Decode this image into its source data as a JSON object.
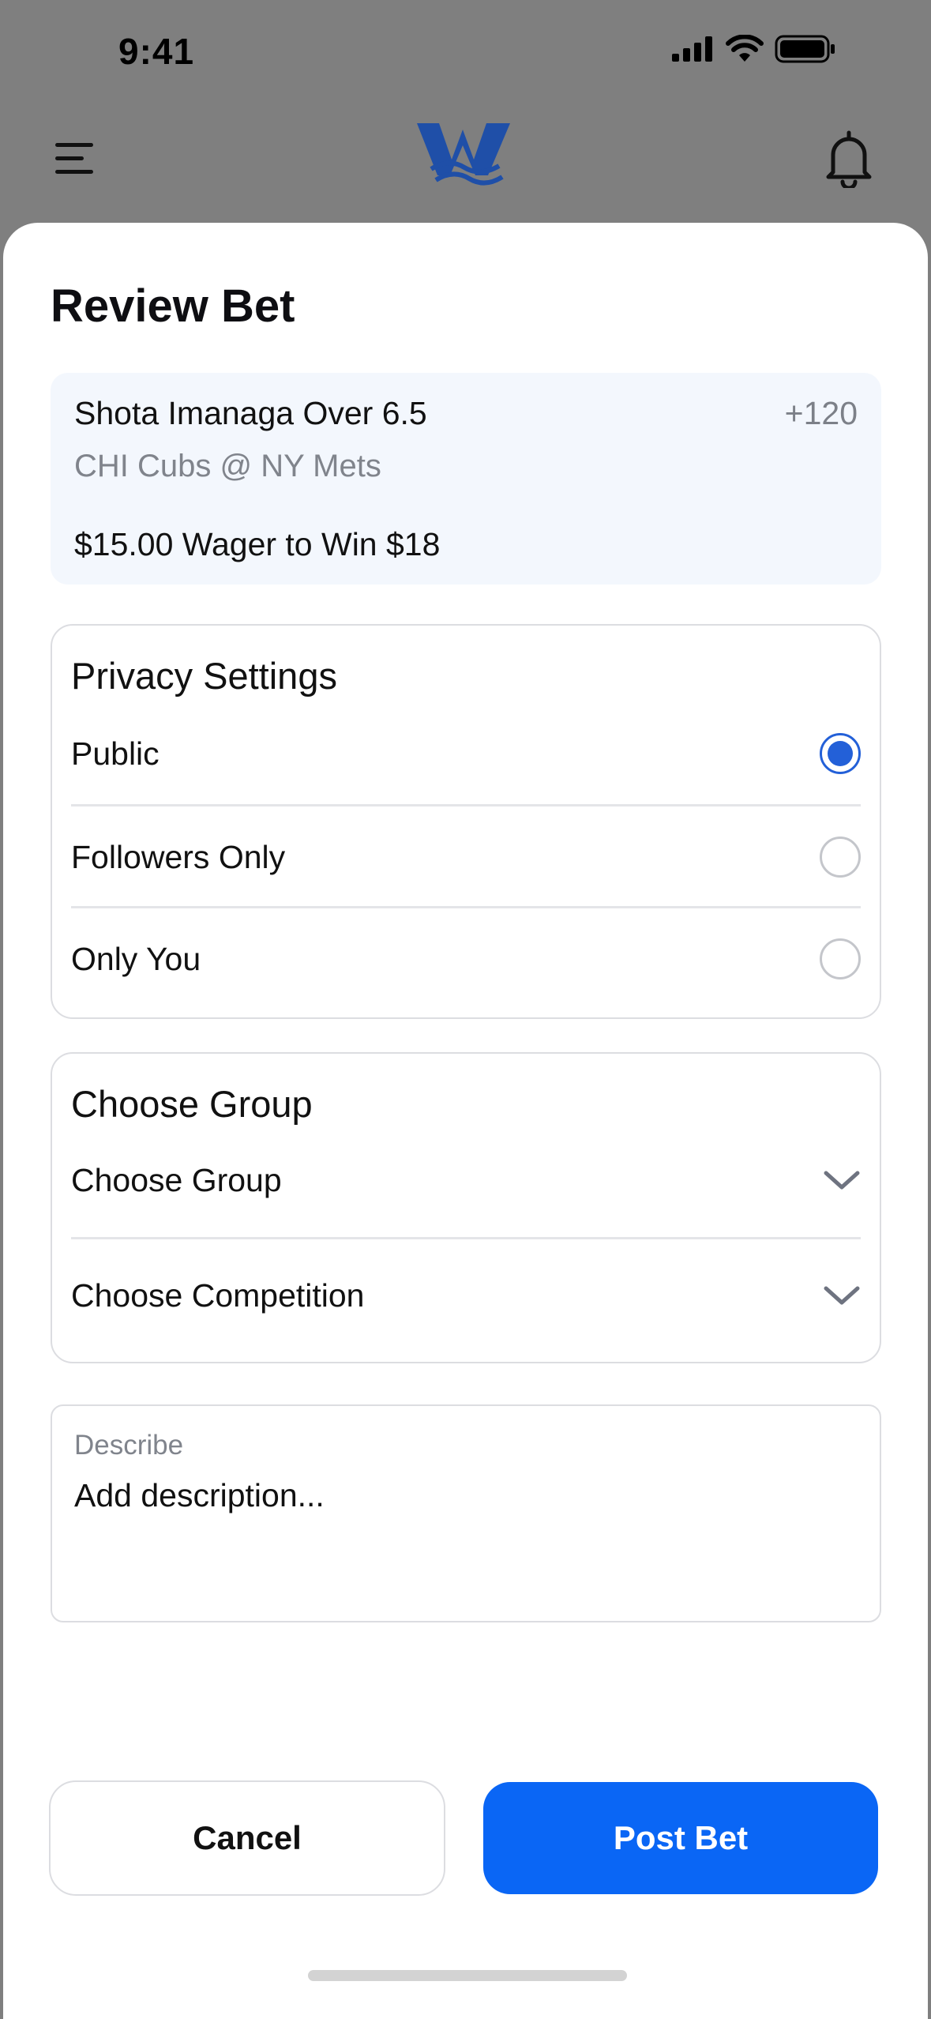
{
  "status_bar": {
    "time": "9:41"
  },
  "header": {
    "logo_name": "app-logo"
  },
  "sheet": {
    "title": "Review Bet",
    "bet": {
      "name": "Shota Imanaga Over 6.5",
      "odds": "+120",
      "game": "CHI Cubs @ NY Mets",
      "wager": "$15.00 Wager to Win $18"
    },
    "privacy": {
      "title": "Privacy Settings",
      "options": [
        {
          "label": "Public",
          "selected": true
        },
        {
          "label": "Followers Only",
          "selected": false
        },
        {
          "label": "Only You",
          "selected": false
        }
      ]
    },
    "group": {
      "title": "Choose Group",
      "selects": [
        {
          "label": "Choose Group"
        },
        {
          "label": "Choose Competition"
        }
      ]
    },
    "describe": {
      "label": "Describe",
      "placeholder": "Add description..."
    },
    "buttons": {
      "cancel": "Cancel",
      "post": "Post Bet"
    }
  },
  "colors": {
    "accent": "#0a66f5",
    "radio_selected": "#2360d8",
    "logo": "#1f4fa8",
    "card_bg": "#f3f7fd"
  }
}
